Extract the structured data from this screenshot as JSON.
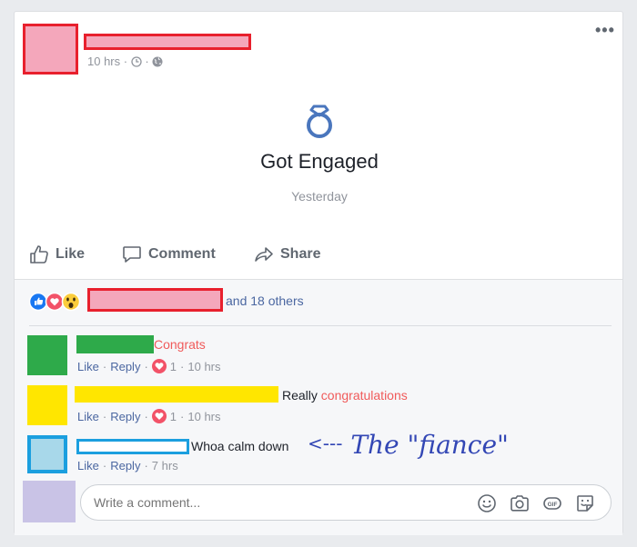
{
  "post": {
    "timestamp": "10 hrs",
    "more_label": "•••",
    "event": {
      "icon": "ring-icon",
      "title": "Got Engaged",
      "date": "Yesterday"
    },
    "actions": {
      "like": "Like",
      "comment": "Comment",
      "share": "Share"
    }
  },
  "reactions": {
    "icons": [
      "like-reaction-icon",
      "love-reaction-icon",
      "wow-reaction-icon"
    ],
    "others_text": "and 18 others"
  },
  "comments": [
    {
      "highlight_text": "Congrats",
      "like": "Like",
      "reply": "Reply",
      "reaction_count": "1",
      "time": "10 hrs",
      "avatar_color": "#2eaa4a"
    },
    {
      "plain_text": "Really",
      "highlight_text": "congratulations",
      "like": "Like",
      "reply": "Reply",
      "reaction_count": "1",
      "time": "10 hrs",
      "avatar_color": "#ffe600"
    },
    {
      "plain_text": "Whoa calm down",
      "like": "Like",
      "reply": "Reply",
      "time": "7 hrs",
      "avatar_color": "#a8d8ea"
    }
  ],
  "annotation": {
    "arrow": "<---",
    "text": "The \"fiance\""
  },
  "composer": {
    "placeholder": "Write a comment..."
  },
  "colors": {
    "redact_border": "#e8202d",
    "redact_fill": "#f4a7bb",
    "green": "#2eaa4a",
    "yellow": "#ffe600",
    "blue_border": "#1b9fdf",
    "highlight_text": "#f05a5a",
    "link": "#4b67a1",
    "annotation": "#3347b5"
  }
}
